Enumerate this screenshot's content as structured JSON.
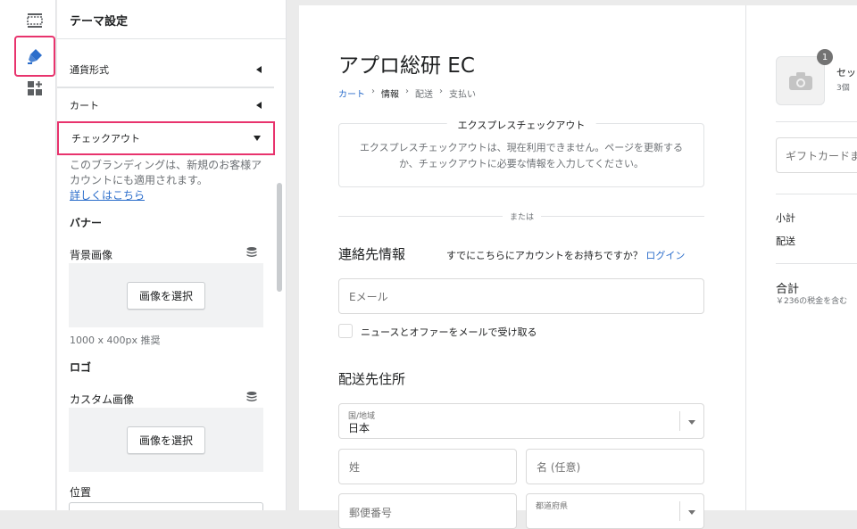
{
  "rail": {
    "items": [
      {
        "icon": "sections-icon"
      },
      {
        "icon": "theme-settings-icon"
      },
      {
        "icon": "apps-icon"
      }
    ],
    "active_color": "#e8336d"
  },
  "panel": {
    "title": "テーマ設定",
    "accordions": [
      {
        "label": "通貨形式"
      },
      {
        "label": "カート"
      },
      {
        "label": "チェックアウト"
      }
    ],
    "description": "このブランディングは、新規のお客様アカウントにも適用されます。",
    "learn_more": "詳しくはこちら",
    "banner": {
      "title": "バナー",
      "background_label": "背景画像",
      "select_button": "画像を選択",
      "hint": "1000 x 400px 推奨"
    },
    "logo": {
      "title": "ロゴ",
      "custom_label": "カスタム画像",
      "select_button": "画像を選択",
      "position_label": "位置"
    }
  },
  "checkout": {
    "store_name": "アプロ総研 EC",
    "breadcrumb": [
      "カート",
      "情報",
      "配送",
      "支払い"
    ],
    "express_title": "エクスプレスチェックアウト",
    "express_message": "エクスプレスチェックアウトは、現在利用できません。ページを更新するか、チェックアウトに必要な情報を入力してください。",
    "or_text": "または",
    "contact_title": "連絡先情報",
    "account_prompt": "すでにこちらにアカウントをお持ちですか？",
    "login_link": "ログイン",
    "email_placeholder": "Eメール",
    "newsletter_label": "ニュースとオファーをメールで受け取る",
    "shipping_title": "配送先住所",
    "country_label": "国/地域",
    "country_value": "日本",
    "last_name_placeholder": "姓",
    "first_name_placeholder": "名 (任意)",
    "postal_placeholder": "郵便番号",
    "prefecture_label": "都道府県"
  },
  "summary": {
    "quantity_badge": "1",
    "item_name": "セッ",
    "item_qty": "3個",
    "gift_placeholder": "ギフトカードま",
    "subtotal_label": "小計",
    "shipping_label": "配送",
    "total_label": "合計",
    "tax_note": "￥236の税金を含む"
  }
}
